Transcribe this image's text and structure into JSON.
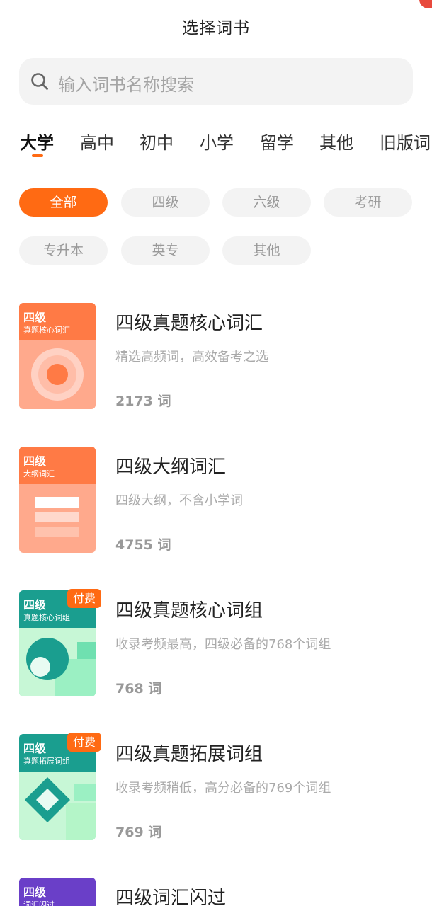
{
  "header": {
    "title": "选择词书"
  },
  "search": {
    "placeholder": "输入词书名称搜索"
  },
  "tabs": [
    "大学",
    "高中",
    "初中",
    "小学",
    "留学",
    "其他",
    "旧版词"
  ],
  "chips": [
    "全部",
    "四级",
    "六级",
    "考研",
    "专升本",
    "英专",
    "其他"
  ],
  "books": [
    {
      "title": "四级真题核心词汇",
      "desc": "精选高频词，高效备考之选",
      "count": "2173 词",
      "cover_level": "四级",
      "cover_sub": "真题核心词汇",
      "paid": false
    },
    {
      "title": "四级大纲词汇",
      "desc": "四级大纲，不含小学词",
      "count": "4755 词",
      "cover_level": "四级",
      "cover_sub": "大纲词汇",
      "paid": false
    },
    {
      "title": "四级真题核心词组",
      "desc": "收录考频最高，四级必备的768个词组",
      "count": "768 词",
      "cover_level": "四级",
      "cover_sub": "真题核心词组",
      "paid": true,
      "paid_label": "付费"
    },
    {
      "title": "四级真题拓展词组",
      "desc": "收录考频稍低，高分必备的769个词组",
      "count": "769 词",
      "cover_level": "四级",
      "cover_sub": "真题拓展词组",
      "paid": true,
      "paid_label": "付费"
    },
    {
      "title": "四级词汇闪过",
      "cover_level": "四级",
      "cover_sub": "词汇闪过",
      "paid": false
    }
  ],
  "colors": {
    "accent": "#ff6a13",
    "orange_cover": "#ff7a45",
    "teal_cover": "#1a9e8f",
    "purple_cover": "#6a3fc8"
  }
}
